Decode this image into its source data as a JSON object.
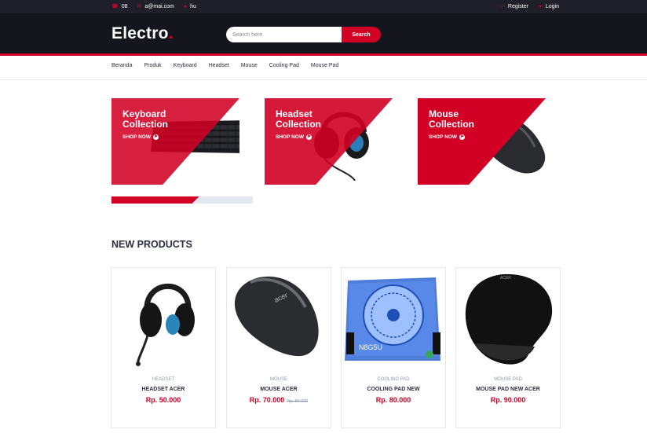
{
  "topbar": {
    "phone": "08",
    "email": "a@mai.com",
    "location": "hu",
    "register": "Register",
    "login": "Login"
  },
  "header": {
    "logo": "Electro",
    "logo_dot": ".",
    "search_placeholder": "Search here",
    "search_button": "Search"
  },
  "nav": [
    "Beranda",
    "Produk",
    "Keyboard",
    "Headset",
    "Mouse",
    "Cooling Pad",
    "Mouse Pad"
  ],
  "collections": [
    {
      "title": "Keyboard Collection",
      "cta": "SHOP NOW"
    },
    {
      "title": "Headset Collection",
      "cta": "SHOP NOW"
    },
    {
      "title": "Mouse Collection",
      "cta": "SHOP NOW"
    }
  ],
  "section": {
    "title": "NEW PRODUCTS"
  },
  "products": [
    {
      "category": "HEADSET",
      "name": "HEADSET ACER",
      "price": "Rp. 50.000",
      "old_price": ""
    },
    {
      "category": "MOUSE",
      "name": "MOUSE ACER",
      "price": "Rp. 70.000",
      "old_price": "Rp. 80.000"
    },
    {
      "category": "COOLING PAD",
      "name": "COOLING PAD NEW",
      "price": "Rp. 80.000",
      "old_price": ""
    },
    {
      "category": "MOUSE PAD",
      "name": "MOUSE PAD NEW ACER",
      "price": "Rp. 90.000",
      "old_price": ""
    }
  ],
  "image_text": {
    "cooling_pad_label": "N8G5U",
    "mouse_brand": "acer",
    "mousepad_brand": "ACER"
  },
  "colors": {
    "accent": "#d10024",
    "dark": "#15161d",
    "topbar": "#1e1f29"
  }
}
